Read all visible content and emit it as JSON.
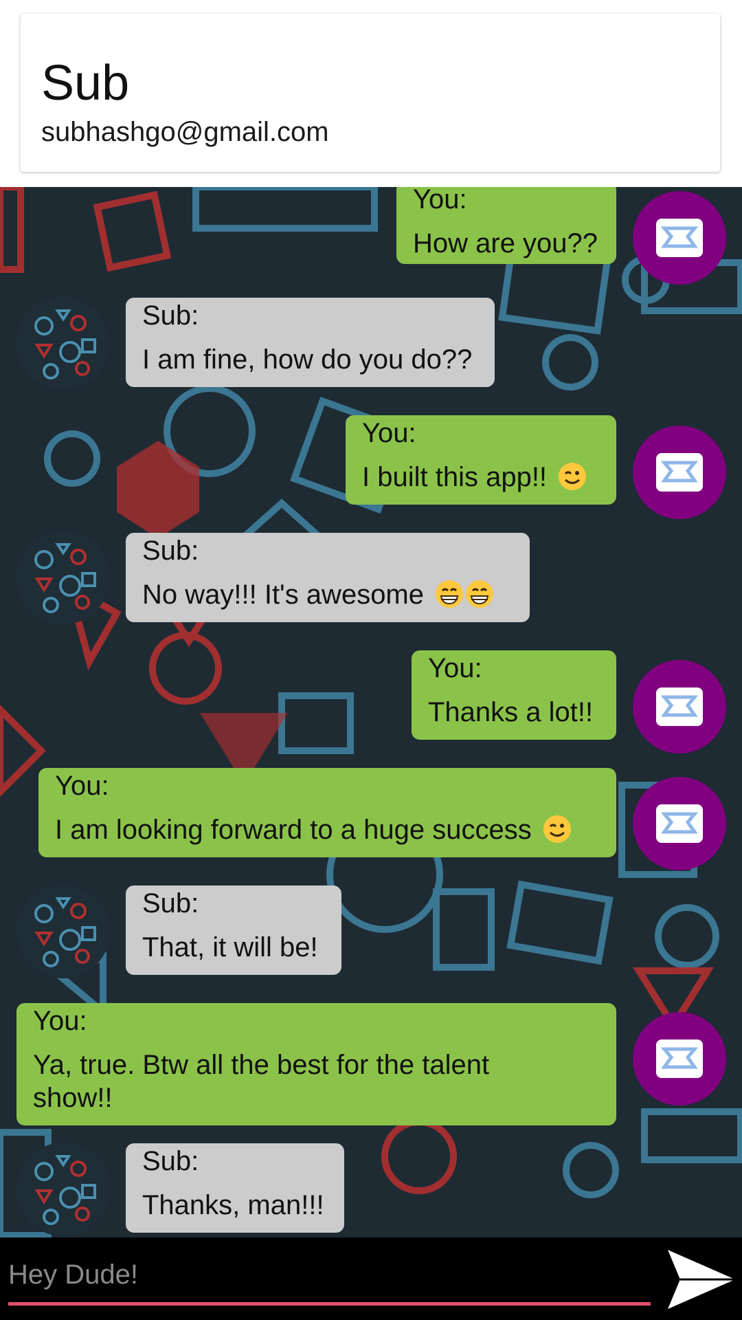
{
  "contact": {
    "name": "Sub",
    "email": "subhashgo@gmail.com"
  },
  "messages": [
    {
      "sender": "You:",
      "text": "How are you??",
      "from": "you"
    },
    {
      "sender": "Sub:",
      "text": "I am fine, how do you do??",
      "from": "sub"
    },
    {
      "sender": "You:",
      "text": "I built this app!!",
      "from": "you",
      "emoji": "winking-face"
    },
    {
      "sender": "Sub:",
      "text": "No way!!! It's awesome",
      "from": "sub",
      "emoji": "grinning-face x2"
    },
    {
      "sender": "You:",
      "text": "Thanks a lot!!",
      "from": "you"
    },
    {
      "sender": "You:",
      "text": "I am looking forward to a huge success",
      "from": "you",
      "emoji": "winking-face"
    },
    {
      "sender": "Sub:",
      "text": "That, it will be!",
      "from": "sub"
    },
    {
      "sender": "You:",
      "text": "Ya, true. Btw all the best for the talent show!!",
      "from": "you"
    },
    {
      "sender": "Sub:",
      "text": "Thanks, man!!!",
      "from": "sub"
    }
  ],
  "composer": {
    "placeholder": "Hey Dude!",
    "send_icon": "send-arrow-icon"
  },
  "colors": {
    "you_bubble": "#8bc34a",
    "sub_bubble": "#cccccc",
    "you_avatar": "#800080",
    "input_underline": "#e5506f",
    "composer_bg": "#000000"
  }
}
